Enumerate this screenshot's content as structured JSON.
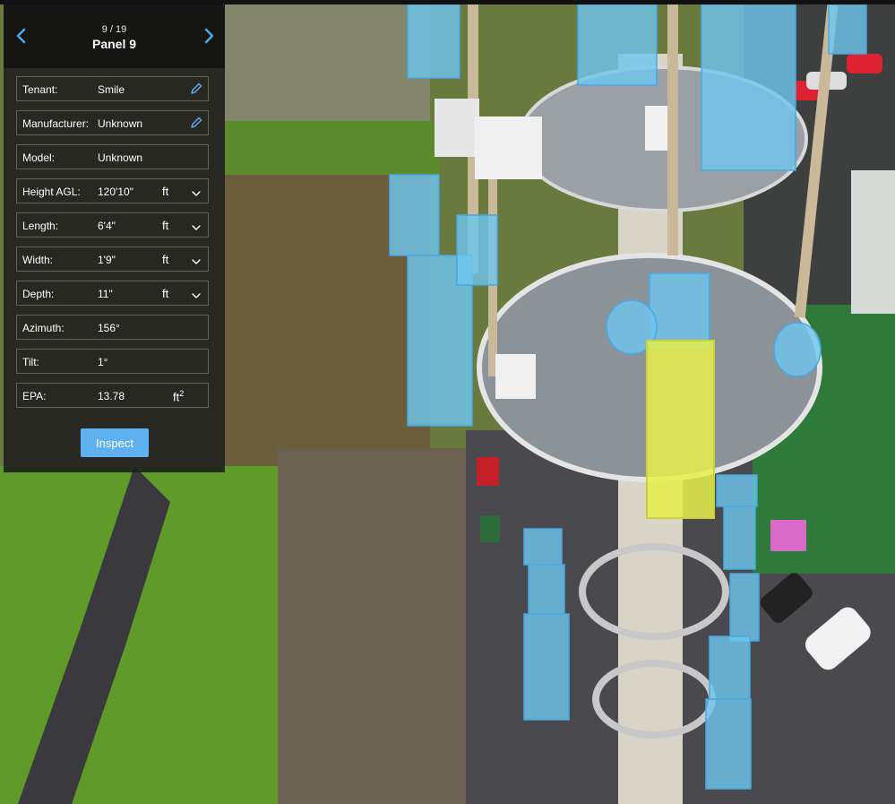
{
  "panel": {
    "counter": "9 / 19",
    "title": "Panel 9",
    "fields": [
      {
        "label": "Tenant:",
        "value": "Smile",
        "editable": true
      },
      {
        "label": "Manufacturer:",
        "value": "Unknown",
        "editable": true
      },
      {
        "label": "Model:",
        "value": "Unknown"
      },
      {
        "label": "Height AGL:",
        "value": "120'10\"",
        "unit": "ft",
        "dropdown": true
      },
      {
        "label": "Length:",
        "value": "6'4\"",
        "unit": "ft",
        "dropdown": true
      },
      {
        "label": "Width:",
        "value": "1'9\"",
        "unit": "ft",
        "dropdown": true
      },
      {
        "label": "Depth:",
        "value": "11\"",
        "unit": "ft",
        "dropdown": true
      },
      {
        "label": "Azimuth:",
        "value": "156°"
      },
      {
        "label": "Tilt:",
        "value": "1°"
      },
      {
        "label": "EPA:",
        "value": "13.78",
        "unit": "ft",
        "unit_sup": "2"
      }
    ],
    "inspect_label": "Inspect"
  },
  "colors": {
    "accent": "#5fb0ef",
    "nav_arrow": "#4aa8e8",
    "antenna_highlight": "#6ec6ef",
    "selected_panel": "#e6f04a"
  },
  "icons": {
    "prev": "chevron-left-icon",
    "next": "chevron-right-icon",
    "edit": "pencil-icon",
    "dropdown": "chevron-down-icon"
  }
}
